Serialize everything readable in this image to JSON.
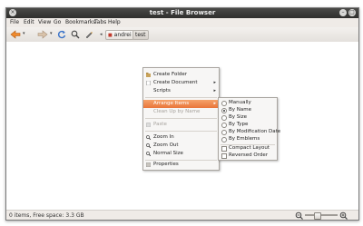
{
  "window": {
    "title": "test - File Browser"
  },
  "menubar": [
    "File",
    "Edit",
    "View",
    "Go",
    "Bookmarks",
    "Tabs",
    "Help"
  ],
  "toolbar": {
    "back_icon": "back-arrow-icon",
    "forward_icon": "forward-arrow-icon",
    "path": [
      "andrei",
      "test"
    ]
  },
  "status": {
    "text": "0 items, Free space: 3.3 GB"
  },
  "context_menu": {
    "create_folder": "Create Folder",
    "create_document": "Create Document",
    "scripts": "Scripts",
    "arrange_items": "Arrange Items",
    "clean_up": "Clean Up by Name",
    "paste": "Paste",
    "zoom_in": "Zoom In",
    "zoom_out": "Zoom Out",
    "normal_size": "Normal Size",
    "properties": "Properties"
  },
  "submenu": {
    "manually": "Manually",
    "by_name": "By Name",
    "by_size": "By Size",
    "by_type": "By Type",
    "by_mod_date": "By Modification Date",
    "by_emblems": "By Emblems",
    "compact_layout": "Compact Layout",
    "reversed_order": "Reversed Order"
  },
  "colors": {
    "highlight": "#ec7f45",
    "titlebar": "#3a3a38",
    "menu_bg": "#f7f6f5"
  }
}
